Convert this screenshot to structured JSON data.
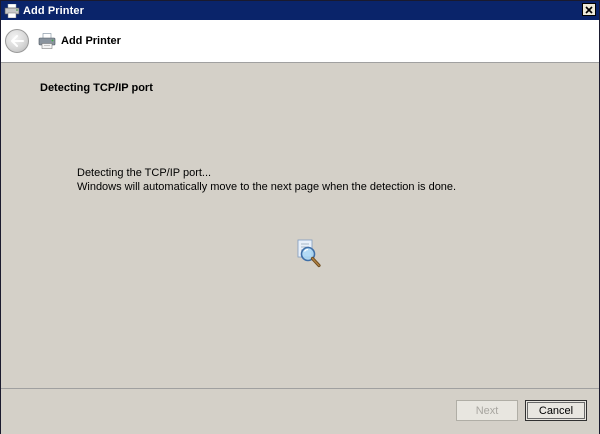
{
  "window": {
    "title": "Add Printer"
  },
  "nav": {
    "title": "Add Printer"
  },
  "content": {
    "heading": "Detecting TCP/IP port",
    "line1": "Detecting the TCP/IP port...",
    "line2": "Windows will automatically move to the next page when the detection is done."
  },
  "footer": {
    "next_label": "Next",
    "cancel_label": "Cancel"
  },
  "icons": {
    "title": "printer-icon",
    "close": "close-icon",
    "back": "back-arrow-icon",
    "nav": "printer-icon",
    "detect": "magnifier-search-icon"
  },
  "colors": {
    "titlebar": "#0a246a",
    "dialog_background": "#d4d0c8",
    "nav_background": "#ffffff"
  }
}
